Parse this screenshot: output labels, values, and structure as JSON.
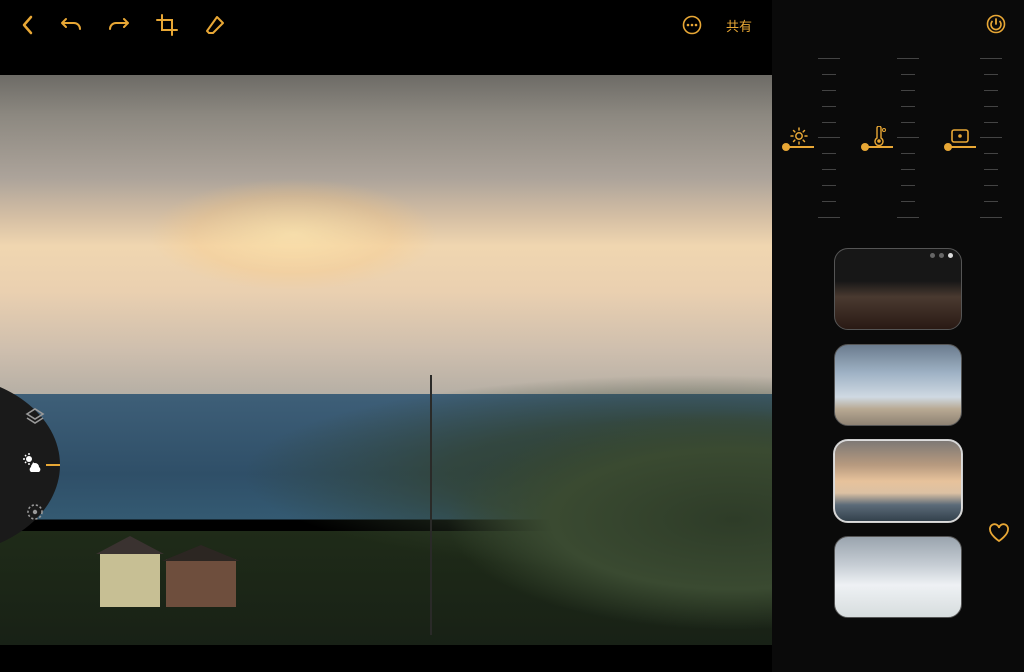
{
  "toolbar": {
    "back_icon": "back",
    "undo_icon": "undo",
    "redo_icon": "redo",
    "crop_icon": "crop",
    "erase_icon": "erase",
    "more_icon": "more",
    "share_label": "共有"
  },
  "wheel": {
    "items": [
      {
        "name": "layers-adjust-icon",
        "active": false
      },
      {
        "name": "sky-weather-icon",
        "active": true
      },
      {
        "name": "time-exposure-icon",
        "active": false
      }
    ]
  },
  "sidebar": {
    "power_icon": "power",
    "sliders": [
      {
        "name": "brightness",
        "icon": "sun-icon",
        "value_pct": 55
      },
      {
        "name": "temperature",
        "icon": "thermometer-icon",
        "value_pct": 55
      },
      {
        "name": "frame",
        "icon": "frame-icon",
        "value_pct": 55
      }
    ],
    "presets": [
      {
        "name": "preset-dusk-dark",
        "selected": false,
        "page_dot": 3
      },
      {
        "name": "preset-blue-sky",
        "selected": false
      },
      {
        "name": "preset-golden-clouds",
        "selected": true
      },
      {
        "name": "preset-overcast-bright",
        "selected": false
      }
    ],
    "favorite_icon": "heart"
  }
}
